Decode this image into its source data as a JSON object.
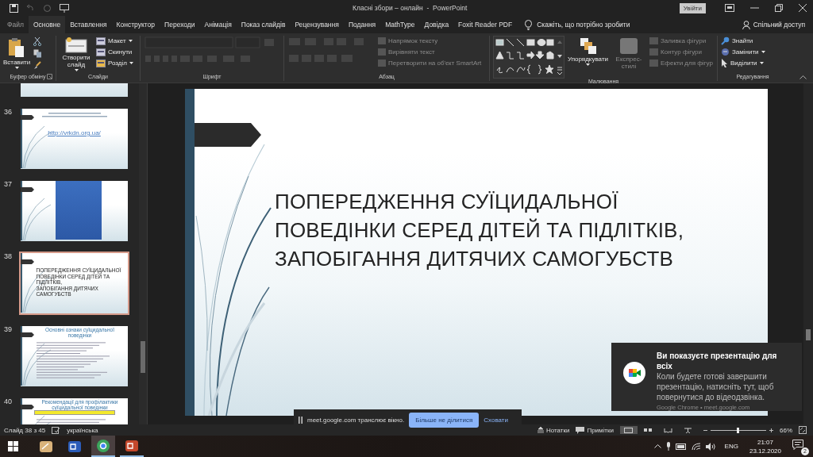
{
  "title_bar": {
    "title": "Класні збори – онлайн  -  PowerPoint",
    "sign_in": "Увійти"
  },
  "tabs": [
    {
      "label": "Файл",
      "selected": false
    },
    {
      "label": "Основне",
      "selected": true
    },
    {
      "label": "Вставлення",
      "selected": false
    },
    {
      "label": "Конструктор",
      "selected": false
    },
    {
      "label": "Переходи",
      "selected": false
    },
    {
      "label": "Анімація",
      "selected": false
    },
    {
      "label": "Показ слайдів",
      "selected": false
    },
    {
      "label": "Рецензування",
      "selected": false
    },
    {
      "label": "Подання",
      "selected": false
    },
    {
      "label": "MathType",
      "selected": false
    },
    {
      "label": "Довідка",
      "selected": false
    },
    {
      "label": "Foxit Reader PDF",
      "selected": false
    }
  ],
  "tell_me": "Скажіть, що потрібно зробити",
  "share": "Спільний доступ",
  "ribbon": {
    "clipboard": {
      "label": "Буфер обміну",
      "paste": "Вставити"
    },
    "slides": {
      "label": "Слайди",
      "new_slide": "Створити слайд",
      "commands": [
        {
          "label": "Макет",
          "disabled": false
        },
        {
          "label": "Скинути",
          "disabled": false
        },
        {
          "label": "Розділ",
          "disabled": false
        }
      ]
    },
    "font": {
      "label": "Шрифт"
    },
    "paragraph": {
      "label": "Абзац",
      "commands": [
        {
          "label": "Напрямок тексту",
          "disabled": true
        },
        {
          "label": "Вирівняти текст",
          "disabled": true
        },
        {
          "label": "Перетворити на об'єкт SmartArt",
          "disabled": true
        }
      ]
    },
    "drawing": {
      "label": "Малювання",
      "arrange": "Упорядкувати",
      "quick_styles": {
        "label": "Експрес-стилі",
        "disabled": true
      },
      "commands": [
        {
          "label": "Заливка фігури",
          "disabled": true
        },
        {
          "label": "Контур фігури",
          "disabled": true
        },
        {
          "label": "Ефекти для фігур",
          "disabled": true
        }
      ]
    },
    "editing": {
      "label": "Редагування",
      "commands": [
        {
          "label": "Знайти",
          "disabled": false
        },
        {
          "label": "Замінити",
          "disabled": false
        },
        {
          "label": "Виділити",
          "disabled": false
        }
      ]
    }
  },
  "slides": [
    {
      "kind": "blank",
      "selected": false
    },
    {
      "number": "36",
      "kind": "link",
      "selected": false,
      "text": "http://vrkdn.org.ua/"
    },
    {
      "number": "37",
      "kind": "picture",
      "selected": false
    },
    {
      "number": "38",
      "kind": "title",
      "selected": true,
      "text": "ПОПЕРЕДЖЕННЯ СУЇЦИДАЛЬНОЇ\nПОВЕДІНКИ СЕРЕД ДІТЕЙ ТА ПІДЛІТКІВ,\nЗАПОБІГАННЯ ДИТЯЧИХ САМОГУБСТВ"
    },
    {
      "number": "39",
      "kind": "list",
      "selected": false,
      "text": "Основні ознаки суїцидальної поведінки"
    },
    {
      "number": "40",
      "kind": "highlight",
      "selected": false,
      "text": "Рекомендації для профілактики суїцидальної поведінки"
    }
  ],
  "current_slide": {
    "title": "ПОПЕРЕДЖЕННЯ СУЇЦИДАЛЬНОЇ\nПОВЕДІНКИ СЕРЕД ДІТЕЙ ТА ПІДЛІТКІВ,\nЗАПОБІГАННЯ ДИТЯЧИХ САМОГУБСТВ"
  },
  "toast": {
    "title": "Ви показуєте презентацію для всіх",
    "body": "Коли будете готові завершити презентацію, натисніть тут, щоб повернутися до відеодзвінка.",
    "source": "Google Chrome • meet.google.com"
  },
  "share_bar": {
    "message": "meet.google.com транслює вікно.",
    "stop_button": "Більше не ділитися",
    "hide_link": "Сховати"
  },
  "status_bar": {
    "slide_counter": "Слайд 38 з 45",
    "language": "українська",
    "notes": "Нотатки",
    "comments": "Примітки",
    "views": [
      {
        "selected": true
      },
      {
        "selected": false
      },
      {
        "selected": false
      },
      {
        "selected": false
      }
    ],
    "zoom_slider": {
      "level": 0.48
    },
    "zoom": "66%"
  },
  "taskbar": {
    "apps": [
      {
        "selected": false,
        "running": false
      },
      {
        "selected": false,
        "running": false
      },
      {
        "selected": true,
        "running": true
      },
      {
        "selected": false,
        "running": true
      }
    ],
    "language": "ENG",
    "time": "21:07",
    "date": "23.12.2020",
    "notifications": "2"
  }
}
